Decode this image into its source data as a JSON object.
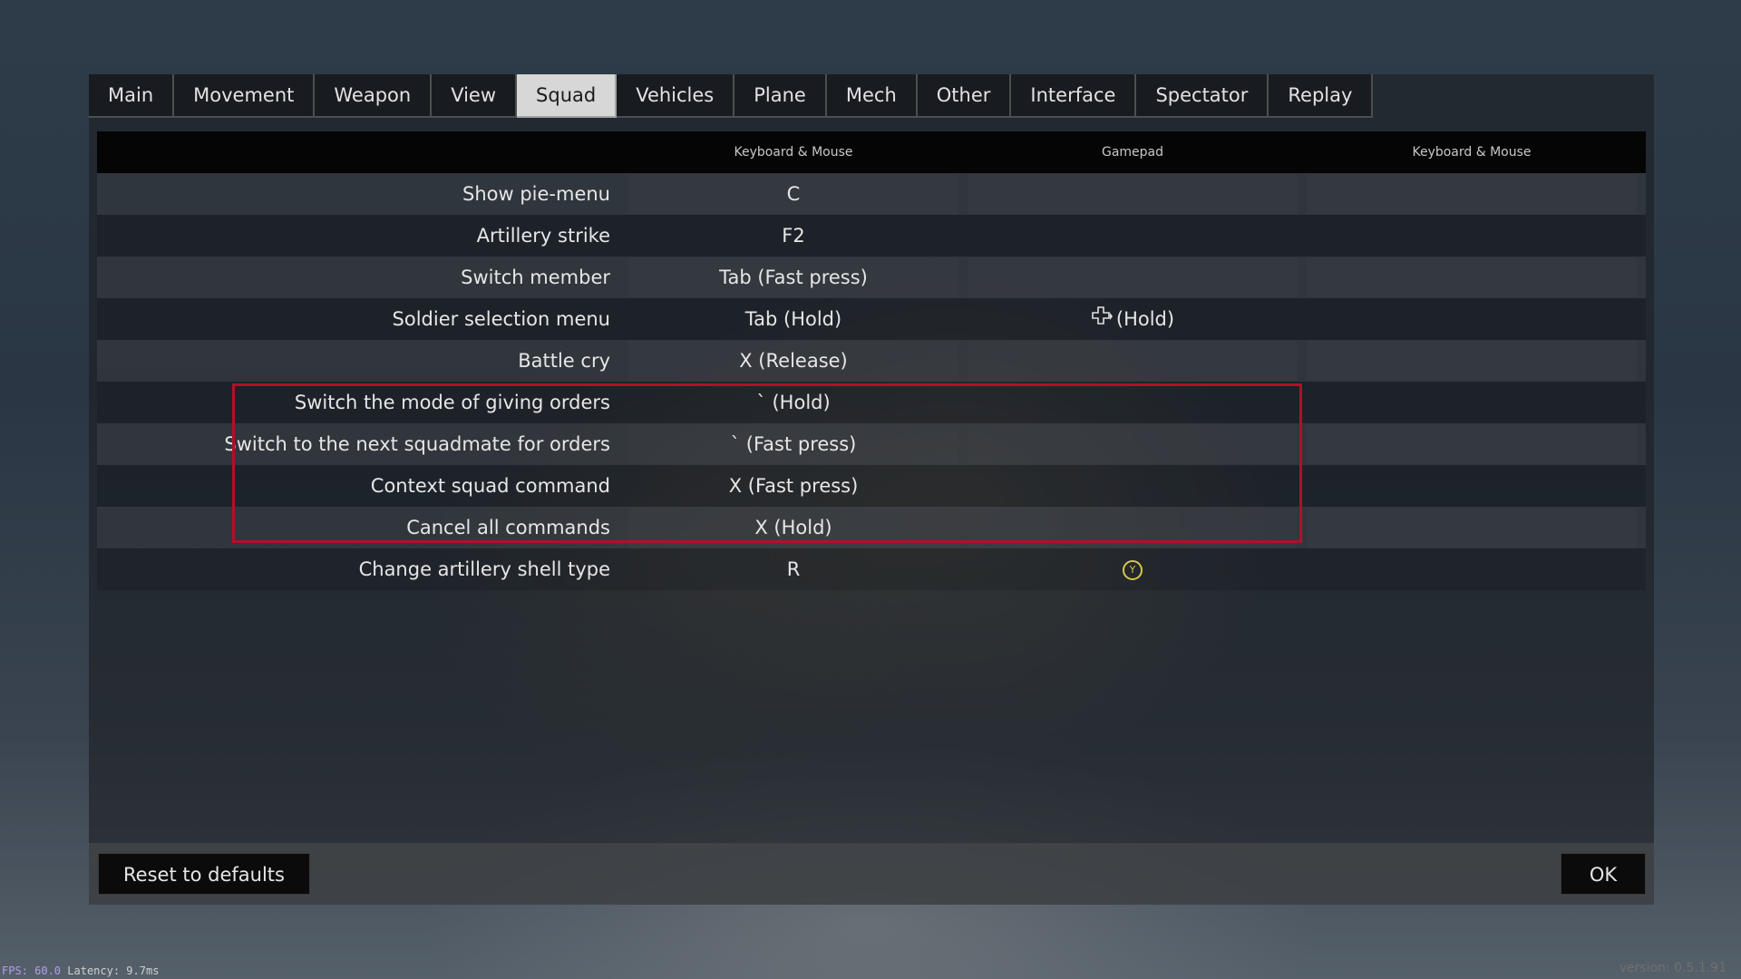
{
  "tabs": [
    {
      "label": "Main",
      "active": false
    },
    {
      "label": "Movement",
      "active": false
    },
    {
      "label": "Weapon",
      "active": false
    },
    {
      "label": "View",
      "active": false
    },
    {
      "label": "Squad",
      "active": true
    },
    {
      "label": "Vehicles",
      "active": false
    },
    {
      "label": "Plane",
      "active": false
    },
    {
      "label": "Mech",
      "active": false
    },
    {
      "label": "Other",
      "active": false
    },
    {
      "label": "Interface",
      "active": false
    },
    {
      "label": "Spectator",
      "active": false
    },
    {
      "label": "Replay",
      "active": false
    }
  ],
  "columns": {
    "keyboard_mouse": "Keyboard & Mouse",
    "gamepad": "Gamepad",
    "keyboard_mouse_alt": "Keyboard & Mouse"
  },
  "bindings": [
    {
      "action": "Show pie-menu",
      "key": "C",
      "gamepad": "",
      "alt": ""
    },
    {
      "action": "Artillery strike",
      "key": "F2",
      "gamepad": "",
      "alt": ""
    },
    {
      "action": "Switch member",
      "key": "Tab (Fast press)",
      "gamepad": "",
      "alt": ""
    },
    {
      "action": "Soldier selection menu",
      "key": "Tab (Hold)",
      "gamepad": "(Hold)",
      "gamepad_icon": "dpad-right-icon",
      "alt": ""
    },
    {
      "action": "Battle cry",
      "key": "X (Release)",
      "gamepad": "",
      "alt": ""
    },
    {
      "action": "Switch the mode of giving orders",
      "key": "` (Hold)",
      "gamepad": "",
      "alt": ""
    },
    {
      "action": "Switch to the next squadmate for orders",
      "key": "` (Fast press)",
      "gamepad": "",
      "alt": ""
    },
    {
      "action": "Context squad command",
      "key": "X (Fast press)",
      "gamepad": "",
      "alt": ""
    },
    {
      "action": "Cancel all commands",
      "key": "X (Hold)",
      "gamepad": "",
      "alt": ""
    },
    {
      "action": "Change artillery shell type",
      "key": "R",
      "gamepad": "Y",
      "gamepad_icon": "y-button-icon",
      "alt": ""
    }
  ],
  "buttons": {
    "reset": "Reset to defaults",
    "ok": "OK"
  },
  "status": {
    "fps_label": "FPS: 60.0",
    "latency_label": "Latency:",
    "latency_value": "9.7ms",
    "version": "version: 0.5.1.91"
  },
  "colors": {
    "highlight_border": "#b0102a",
    "active_tab": "#d7d7d7",
    "gamepad_y": "#d3c74a"
  }
}
